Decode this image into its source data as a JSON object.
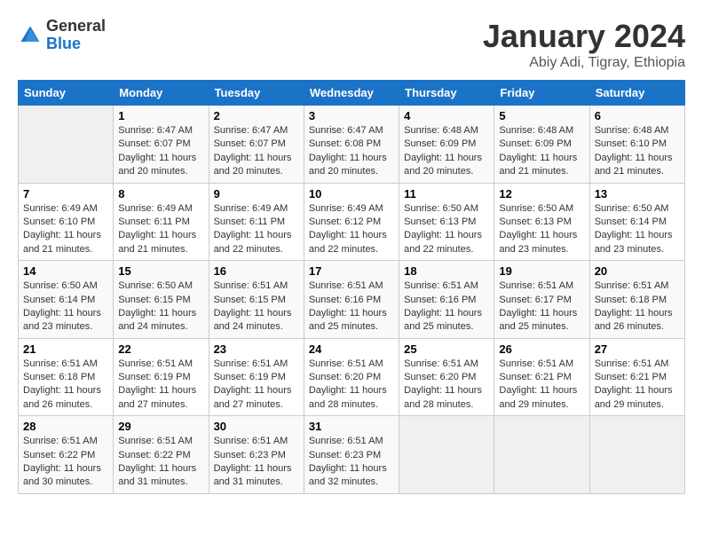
{
  "logo": {
    "line1": "General",
    "line2": "Blue"
  },
  "title": "January 2024",
  "subtitle": "Abiy Adi, Tigray, Ethiopia",
  "weekdays": [
    "Sunday",
    "Monday",
    "Tuesday",
    "Wednesday",
    "Thursday",
    "Friday",
    "Saturday"
  ],
  "weeks": [
    [
      {
        "day": "",
        "sunrise": "",
        "sunset": "",
        "daylight": ""
      },
      {
        "day": "1",
        "sunrise": "Sunrise: 6:47 AM",
        "sunset": "Sunset: 6:07 PM",
        "daylight": "Daylight: 11 hours and 20 minutes."
      },
      {
        "day": "2",
        "sunrise": "Sunrise: 6:47 AM",
        "sunset": "Sunset: 6:07 PM",
        "daylight": "Daylight: 11 hours and 20 minutes."
      },
      {
        "day": "3",
        "sunrise": "Sunrise: 6:47 AM",
        "sunset": "Sunset: 6:08 PM",
        "daylight": "Daylight: 11 hours and 20 minutes."
      },
      {
        "day": "4",
        "sunrise": "Sunrise: 6:48 AM",
        "sunset": "Sunset: 6:09 PM",
        "daylight": "Daylight: 11 hours and 20 minutes."
      },
      {
        "day": "5",
        "sunrise": "Sunrise: 6:48 AM",
        "sunset": "Sunset: 6:09 PM",
        "daylight": "Daylight: 11 hours and 21 minutes."
      },
      {
        "day": "6",
        "sunrise": "Sunrise: 6:48 AM",
        "sunset": "Sunset: 6:10 PM",
        "daylight": "Daylight: 11 hours and 21 minutes."
      }
    ],
    [
      {
        "day": "7",
        "sunrise": "Sunrise: 6:49 AM",
        "sunset": "Sunset: 6:10 PM",
        "daylight": "Daylight: 11 hours and 21 minutes."
      },
      {
        "day": "8",
        "sunrise": "Sunrise: 6:49 AM",
        "sunset": "Sunset: 6:11 PM",
        "daylight": "Daylight: 11 hours and 21 minutes."
      },
      {
        "day": "9",
        "sunrise": "Sunrise: 6:49 AM",
        "sunset": "Sunset: 6:11 PM",
        "daylight": "Daylight: 11 hours and 22 minutes."
      },
      {
        "day": "10",
        "sunrise": "Sunrise: 6:49 AM",
        "sunset": "Sunset: 6:12 PM",
        "daylight": "Daylight: 11 hours and 22 minutes."
      },
      {
        "day": "11",
        "sunrise": "Sunrise: 6:50 AM",
        "sunset": "Sunset: 6:13 PM",
        "daylight": "Daylight: 11 hours and 22 minutes."
      },
      {
        "day": "12",
        "sunrise": "Sunrise: 6:50 AM",
        "sunset": "Sunset: 6:13 PM",
        "daylight": "Daylight: 11 hours and 23 minutes."
      },
      {
        "day": "13",
        "sunrise": "Sunrise: 6:50 AM",
        "sunset": "Sunset: 6:14 PM",
        "daylight": "Daylight: 11 hours and 23 minutes."
      }
    ],
    [
      {
        "day": "14",
        "sunrise": "Sunrise: 6:50 AM",
        "sunset": "Sunset: 6:14 PM",
        "daylight": "Daylight: 11 hours and 23 minutes."
      },
      {
        "day": "15",
        "sunrise": "Sunrise: 6:50 AM",
        "sunset": "Sunset: 6:15 PM",
        "daylight": "Daylight: 11 hours and 24 minutes."
      },
      {
        "day": "16",
        "sunrise": "Sunrise: 6:51 AM",
        "sunset": "Sunset: 6:15 PM",
        "daylight": "Daylight: 11 hours and 24 minutes."
      },
      {
        "day": "17",
        "sunrise": "Sunrise: 6:51 AM",
        "sunset": "Sunset: 6:16 PM",
        "daylight": "Daylight: 11 hours and 25 minutes."
      },
      {
        "day": "18",
        "sunrise": "Sunrise: 6:51 AM",
        "sunset": "Sunset: 6:16 PM",
        "daylight": "Daylight: 11 hours and 25 minutes."
      },
      {
        "day": "19",
        "sunrise": "Sunrise: 6:51 AM",
        "sunset": "Sunset: 6:17 PM",
        "daylight": "Daylight: 11 hours and 25 minutes."
      },
      {
        "day": "20",
        "sunrise": "Sunrise: 6:51 AM",
        "sunset": "Sunset: 6:18 PM",
        "daylight": "Daylight: 11 hours and 26 minutes."
      }
    ],
    [
      {
        "day": "21",
        "sunrise": "Sunrise: 6:51 AM",
        "sunset": "Sunset: 6:18 PM",
        "daylight": "Daylight: 11 hours and 26 minutes."
      },
      {
        "day": "22",
        "sunrise": "Sunrise: 6:51 AM",
        "sunset": "Sunset: 6:19 PM",
        "daylight": "Daylight: 11 hours and 27 minutes."
      },
      {
        "day": "23",
        "sunrise": "Sunrise: 6:51 AM",
        "sunset": "Sunset: 6:19 PM",
        "daylight": "Daylight: 11 hours and 27 minutes."
      },
      {
        "day": "24",
        "sunrise": "Sunrise: 6:51 AM",
        "sunset": "Sunset: 6:20 PM",
        "daylight": "Daylight: 11 hours and 28 minutes."
      },
      {
        "day": "25",
        "sunrise": "Sunrise: 6:51 AM",
        "sunset": "Sunset: 6:20 PM",
        "daylight": "Daylight: 11 hours and 28 minutes."
      },
      {
        "day": "26",
        "sunrise": "Sunrise: 6:51 AM",
        "sunset": "Sunset: 6:21 PM",
        "daylight": "Daylight: 11 hours and 29 minutes."
      },
      {
        "day": "27",
        "sunrise": "Sunrise: 6:51 AM",
        "sunset": "Sunset: 6:21 PM",
        "daylight": "Daylight: 11 hours and 29 minutes."
      }
    ],
    [
      {
        "day": "28",
        "sunrise": "Sunrise: 6:51 AM",
        "sunset": "Sunset: 6:22 PM",
        "daylight": "Daylight: 11 hours and 30 minutes."
      },
      {
        "day": "29",
        "sunrise": "Sunrise: 6:51 AM",
        "sunset": "Sunset: 6:22 PM",
        "daylight": "Daylight: 11 hours and 31 minutes."
      },
      {
        "day": "30",
        "sunrise": "Sunrise: 6:51 AM",
        "sunset": "Sunset: 6:23 PM",
        "daylight": "Daylight: 11 hours and 31 minutes."
      },
      {
        "day": "31",
        "sunrise": "Sunrise: 6:51 AM",
        "sunset": "Sunset: 6:23 PM",
        "daylight": "Daylight: 11 hours and 32 minutes."
      },
      {
        "day": "",
        "sunrise": "",
        "sunset": "",
        "daylight": ""
      },
      {
        "day": "",
        "sunrise": "",
        "sunset": "",
        "daylight": ""
      },
      {
        "day": "",
        "sunrise": "",
        "sunset": "",
        "daylight": ""
      }
    ]
  ]
}
